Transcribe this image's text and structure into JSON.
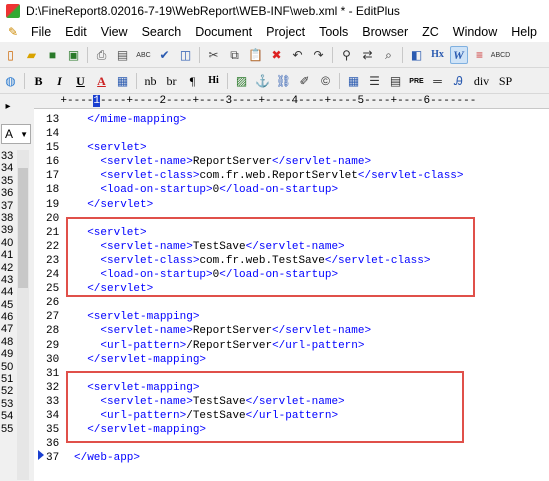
{
  "window": {
    "title": "D:\\FineReport8.02016-7-19\\WebReport\\WEB-INF\\web.xml * - EditPlus"
  },
  "menu": {
    "items": [
      {
        "name": "file",
        "label": "File"
      },
      {
        "name": "edit",
        "label": "Edit"
      },
      {
        "name": "view",
        "label": "View"
      },
      {
        "name": "search",
        "label": "Search"
      },
      {
        "name": "document",
        "label": "Document"
      },
      {
        "name": "project",
        "label": "Project"
      },
      {
        "name": "tools",
        "label": "Tools"
      },
      {
        "name": "browser",
        "label": "Browser"
      },
      {
        "name": "zc",
        "label": "ZC"
      },
      {
        "name": "window",
        "label": "Window"
      },
      {
        "name": "help",
        "label": "Help"
      }
    ]
  },
  "toolbar2": {
    "bold": "B",
    "italic": "I",
    "underline": "U",
    "font_color": "A",
    "nb": "nb",
    "br": "br",
    "para": "¶",
    "hi": "Hi",
    "pre": "PRE",
    "div": "div",
    "sp": "SP",
    "hx": "Hx",
    "w": "W"
  },
  "sidebar": {
    "tab_label": "A",
    "dropdown_value": "A",
    "numbers": [
      "33",
      "34",
      "35",
      "36",
      "37",
      "38",
      "39",
      "40",
      "41",
      "42",
      "43",
      "44",
      "45",
      "46",
      "47",
      "48",
      "49",
      "50",
      "51",
      "52",
      "53",
      "54",
      "55"
    ]
  },
  "ruler": {
    "text": "+----1----+----2----+----3----+----4----+----5----+----6-------"
  },
  "editor": {
    "line_numbers": [
      "13",
      "14",
      "15",
      "16",
      "17",
      "18",
      "19",
      "20",
      "21",
      "22",
      "23",
      "24",
      "25",
      "26",
      "27",
      "28",
      "29",
      "30",
      "31",
      "32",
      "33",
      "34",
      "35",
      "36",
      "37"
    ],
    "lines": [
      {
        "indent": "  ",
        "pre": "</mime-mapping>",
        "text": "",
        "post": ""
      },
      {
        "indent": "",
        "pre": "",
        "text": "",
        "post": ""
      },
      {
        "indent": "  ",
        "pre": "<servlet>",
        "text": "",
        "post": ""
      },
      {
        "indent": "    ",
        "pre": "<servlet-name>",
        "text": "ReportServer",
        "post": "</servlet-name>"
      },
      {
        "indent": "    ",
        "pre": "<servlet-class>",
        "text": "com.fr.web.ReportServlet",
        "post": "</servlet-class>"
      },
      {
        "indent": "    ",
        "pre": "<load-on-startup>",
        "text": "0",
        "post": "</load-on-startup>"
      },
      {
        "indent": "  ",
        "pre": "</servlet>",
        "text": "",
        "post": ""
      },
      {
        "indent": "",
        "pre": "",
        "text": "",
        "post": ""
      },
      {
        "indent": "  ",
        "pre": "<servlet>",
        "text": "",
        "post": ""
      },
      {
        "indent": "    ",
        "pre": "<servlet-name>",
        "text": "TestSave",
        "post": "</servlet-name>"
      },
      {
        "indent": "    ",
        "pre": "<servlet-class>",
        "text": "com.fr.web.TestSave",
        "post": "</servlet-class>"
      },
      {
        "indent": "    ",
        "pre": "<load-on-startup>",
        "text": "0",
        "post": "</load-on-startup>"
      },
      {
        "indent": "  ",
        "pre": "</servlet>",
        "text": "",
        "post": ""
      },
      {
        "indent": "",
        "pre": "",
        "text": "",
        "post": ""
      },
      {
        "indent": "  ",
        "pre": "<servlet-mapping>",
        "text": "",
        "post": ""
      },
      {
        "indent": "    ",
        "pre": "<servlet-name>",
        "text": "ReportServer",
        "post": "</servlet-name>"
      },
      {
        "indent": "    ",
        "pre": "<url-pattern>",
        "text": "/ReportServer",
        "post": "</url-pattern>"
      },
      {
        "indent": "  ",
        "pre": "</servlet-mapping>",
        "text": "",
        "post": ""
      },
      {
        "indent": "",
        "pre": "",
        "text": "",
        "post": ""
      },
      {
        "indent": "  ",
        "pre": "<servlet-mapping>",
        "text": "",
        "post": ""
      },
      {
        "indent": "    ",
        "pre": "<servlet-name>",
        "text": "TestSave",
        "post": "</servlet-name>"
      },
      {
        "indent": "    ",
        "pre": "<url-pattern>",
        "text": "/TestSave",
        "post": "</url-pattern>"
      },
      {
        "indent": "  ",
        "pre": "</servlet-mapping>",
        "text": "",
        "post": ""
      },
      {
        "indent": "",
        "pre": "",
        "text": "",
        "post": ""
      },
      {
        "indent": "",
        "pre": "</web-app>",
        "text": "",
        "post": ""
      }
    ]
  },
  "colors": {
    "tag": "#0000ff",
    "text": "#000000",
    "highlight_box": "#e0504a",
    "cursor_marker": "#1a3fd0"
  }
}
